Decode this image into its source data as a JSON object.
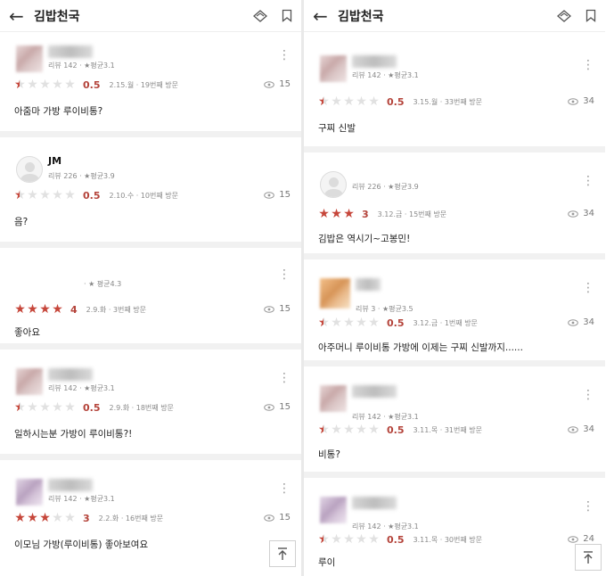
{
  "left_panel": {
    "header": {
      "title": "김밥천국"
    },
    "reviews": [
      {
        "name": "",
        "meta": "리뷰 142 · ★평균3.1",
        "score": "0.5",
        "stars": [
          0.5,
          0,
          0,
          0,
          0
        ],
        "date_visit": "2.15.월 · 19번째 방문",
        "views": "15",
        "text": "아줌마 가방 루이비통?"
      },
      {
        "name": "JM",
        "meta": "리뷰 226 · ★평균3.9",
        "score": "0.5",
        "stars": [
          0.5,
          0,
          0,
          0,
          0
        ],
        "date_visit": "2.10.수 · 10번째 방문",
        "views": "15",
        "text": "음?"
      },
      {
        "name": "",
        "meta": "· ★ 평균4.3",
        "score": "4",
        "stars": [
          1,
          1,
          1,
          1,
          0
        ],
        "date_visit": "2.9.화 · 3번째 방문",
        "views": "15",
        "text": "좋아요"
      },
      {
        "name": "",
        "meta": "리뷰 142 · ★평균3.1",
        "score": "0.5",
        "stars": [
          0.5,
          0,
          0,
          0,
          0
        ],
        "date_visit": "2.9.화 · 18번째 방문",
        "views": "15",
        "text": "일하시는분 가방이 루이비통?!"
      },
      {
        "name": "",
        "meta": "리뷰 142 · ★평균3.1",
        "score": "3",
        "stars": [
          1,
          1,
          1,
          0,
          0
        ],
        "date_visit": "2.2.화 · 16번째 방문",
        "views": "15",
        "text": "이모님 가방(루이비통) 좋아보여요"
      }
    ]
  },
  "right_panel": {
    "header": {
      "title": "김밥천국"
    },
    "reviews": [
      {
        "name": "",
        "meta": "리뷰 142 · ★평균3.1",
        "score": "0.5",
        "stars": [
          0.5,
          0,
          0,
          0,
          0
        ],
        "date_visit": "3.15.월 · 33번째 방문",
        "views": "34",
        "text": "구찌 신발"
      },
      {
        "name": "",
        "meta": "리뷰 226 · ★평균3.9",
        "score": "3",
        "stars": [
          1,
          1,
          1,
          0,
          0
        ],
        "date_visit": "3.12.금 · 15번째 방문",
        "views": "34",
        "text": "김밥은 역시기~고봉민!"
      },
      {
        "name": "",
        "meta": "리뷰 3 · ★평균3.5",
        "score": "0.5",
        "stars": [
          0.5,
          0,
          0,
          0,
          0
        ],
        "date_visit": "3.12.금 · 1번째 방문",
        "views": "34",
        "text": "아주머니 루이비통 가방에 이제는 구찌 신발까지......"
      },
      {
        "name": "",
        "meta": "리뷰 142 · ★평균3.1",
        "score": "0.5",
        "stars": [
          0.5,
          0,
          0,
          0,
          0
        ],
        "date_visit": "3.11.목 · 31번째 방문",
        "views": "34",
        "text": "비통?"
      },
      {
        "name": "",
        "meta": "리뷰 142 · ★평균3.1",
        "score": "0.5",
        "stars": [
          0.5,
          0,
          0,
          0,
          0
        ],
        "date_visit": "3.11.목 · 30번째 방문",
        "views": "24",
        "text": "루이"
      }
    ]
  },
  "icons": {
    "back": "arrow-left-icon",
    "share": "diamond-share-icon",
    "bookmark": "bookmark-icon",
    "views": "eye-icon",
    "more": "more-vertical-icon",
    "scroll_top": "scroll-to-top-icon"
  },
  "colors": {
    "star_active": "#c6463a",
    "score": "#b4433a",
    "star_inactive": "#e1e1e1"
  }
}
